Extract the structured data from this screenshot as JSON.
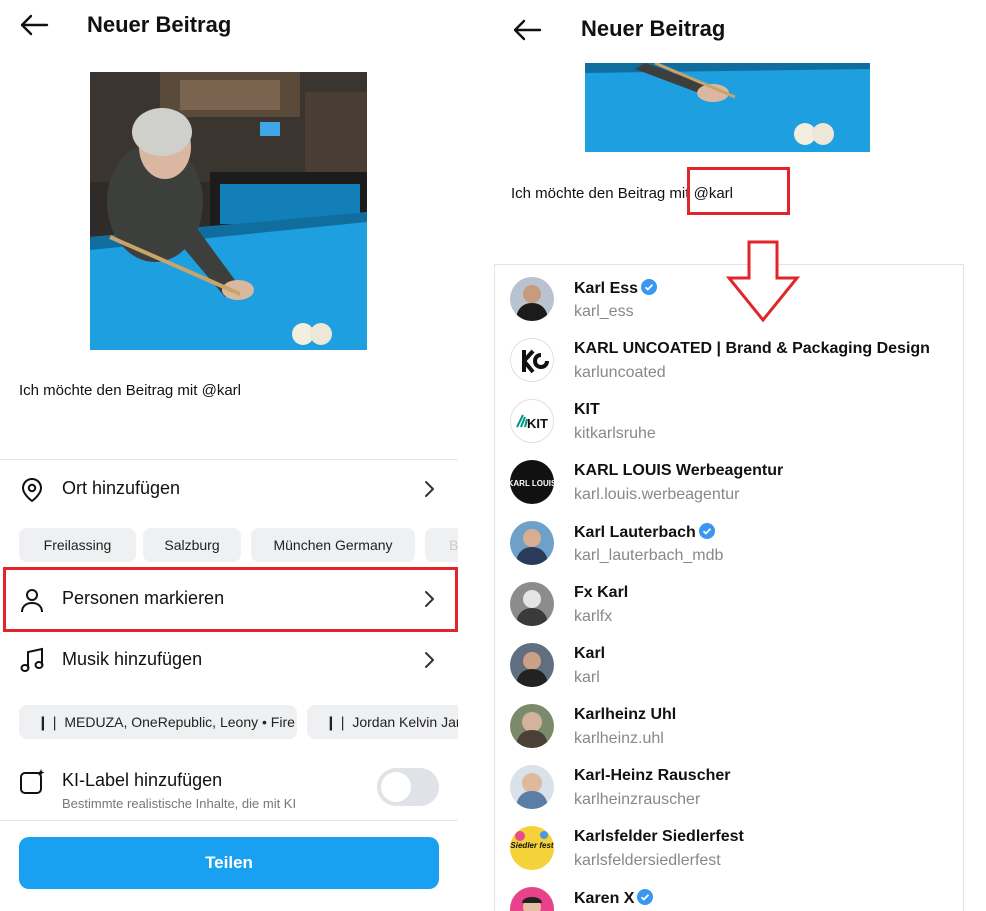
{
  "left": {
    "title": "Neuer Beitrag",
    "caption": "Ich möchte den Beitrag mit @karl",
    "location_label": "Ort hinzufügen",
    "location_chips": [
      "Freilassing",
      "Salzburg",
      "München Germany",
      "B"
    ],
    "tag_people_label": "Personen markieren",
    "music_label": "Musik hinzufügen",
    "music_chips": [
      "MEDUZA, OneRepublic, Leony • Fire",
      "Jordan Kelvin Jam"
    ],
    "ai_label": "KI-Label hinzufügen",
    "ai_sub": "Bestimmte realistische Inhalte, die mit KI",
    "ai_toggle_on": false,
    "share_label": "Teilen"
  },
  "right": {
    "title": "Neuer Beitrag",
    "caption": "Ich möchte den Beitrag mit @karl",
    "suggestions": [
      {
        "name": "Karl Ess",
        "handle": "karl_ess",
        "verified": true
      },
      {
        "name": "KARL UNCOATED | Brand & Packaging Design",
        "handle": "karluncoated",
        "verified": false
      },
      {
        "name": "KIT",
        "handle": "kitkarlsruhe",
        "verified": false
      },
      {
        "name": "KARL LOUIS Werbeagentur",
        "handle": "karl.louis.werbeagentur",
        "verified": false
      },
      {
        "name": "Karl Lauterbach",
        "handle": "karl_lauterbach_mdb",
        "verified": true
      },
      {
        "name": "Fx Karl",
        "handle": "karlfx",
        "verified": false
      },
      {
        "name": "Karl",
        "handle": "karl",
        "verified": false
      },
      {
        "name": "Karlheinz Uhl",
        "handle": "karlheinz.uhl",
        "verified": false
      },
      {
        "name": "Karl-Heinz Rauscher",
        "handle": "karlheinzrauscher",
        "verified": false
      },
      {
        "name": "Karlsfelder Siedlerfest",
        "handle": "karlsfeldersiedlerfest",
        "verified": false
      },
      {
        "name": "Karen X",
        "handle": "",
        "verified": true
      }
    ],
    "logo_text": {
      "kit": "KIT",
      "karl_louis": "KARL LOUIS",
      "siedlerfest": "Siedler fest"
    }
  },
  "colors": {
    "accent": "#1aa0f0",
    "highlight_red": "#e0262b",
    "verified_blue": "#3897f0",
    "pool_table": "#1e9fe0"
  },
  "icons": [
    "back-arrow-icon",
    "location-pin-icon",
    "person-icon",
    "music-note-icon",
    "ai-label-icon",
    "chevron-right-icon",
    "verified-badge-icon",
    "down-arrow-icon"
  ]
}
